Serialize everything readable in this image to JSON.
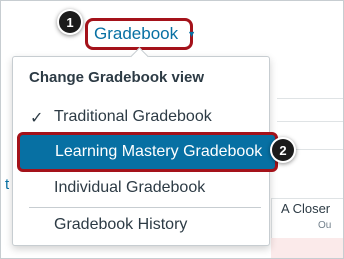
{
  "trigger": {
    "label": "Gradebook",
    "caret": "▼"
  },
  "callouts": [
    "1",
    "2"
  ],
  "menu": {
    "header": "Change Gradebook view",
    "items": [
      {
        "label": "Traditional Gradebook",
        "checked": true
      },
      {
        "label": "Learning Mastery Gradebook",
        "highlighted": true
      },
      {
        "label": "Individual Gradebook"
      },
      {
        "label": "Gradebook History"
      }
    ]
  },
  "background": {
    "left_link": "t",
    "column_title": "A Closer",
    "column_sub": "Ou"
  },
  "colors": {
    "accent": "#0770a3",
    "callout_border": "#a4121a",
    "callout_bg": "#1b1b1b"
  }
}
